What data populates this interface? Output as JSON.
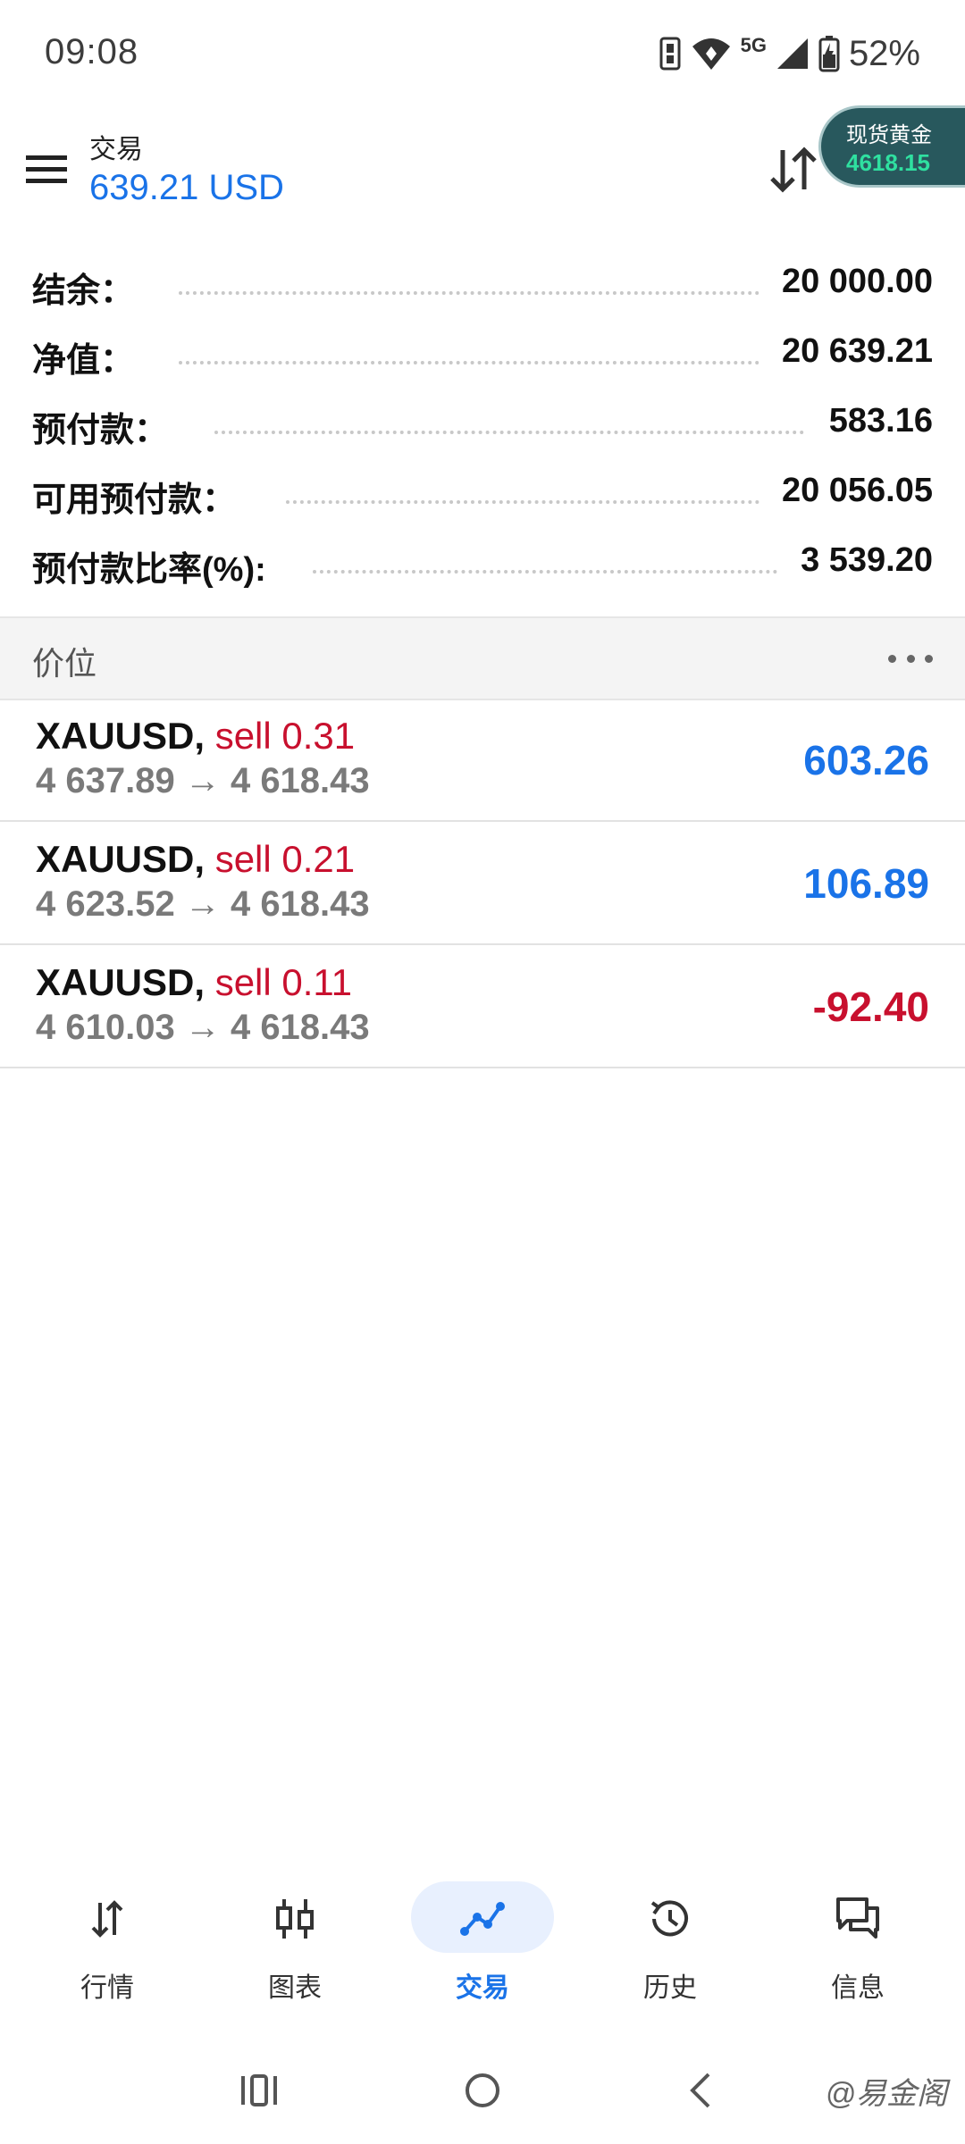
{
  "status_bar": {
    "time": "09:08",
    "network": "5G",
    "battery": "52%"
  },
  "header": {
    "title": "交易",
    "profit": "639.21 USD",
    "ticker": {
      "label": "现货黄金",
      "value": "4618.15"
    }
  },
  "summary": [
    {
      "label": "结余：",
      "value": "20 000.00"
    },
    {
      "label": "净值：",
      "value": "20 639.21"
    },
    {
      "label": "预付款：",
      "value": "583.16"
    },
    {
      "label": "可用预付款：",
      "value": "20 056.05"
    },
    {
      "label": "预付款比率(%):",
      "value": "3 539.20"
    }
  ],
  "section": {
    "title": "价位"
  },
  "positions": [
    {
      "symbol": "XAUUSD,",
      "side": "sell 0.31",
      "price_open": "4 637.89",
      "arrow": "→",
      "price_current": "4 618.43",
      "profit": "603.26"
    },
    {
      "symbol": "XAUUSD,",
      "side": "sell 0.21",
      "price_open": "4 623.52",
      "arrow": "→",
      "price_current": "4 618.43",
      "profit": "106.89"
    },
    {
      "symbol": "XAUUSD,",
      "side": "sell 0.11",
      "price_open": "4 610.03",
      "arrow": "→",
      "price_current": "4 618.43",
      "profit": "-92.40"
    }
  ],
  "colors": {
    "accent": "#1a73e8",
    "profit_positive": "#1a73e8",
    "profit_negative": "#c8102e",
    "sell": "#c8102e",
    "ticker_bg": "#28585d",
    "ticker_value": "#2fe0a0"
  },
  "bottom_nav": [
    {
      "label": "行情",
      "icon": "quotes-icon",
      "active": false
    },
    {
      "label": "图表",
      "icon": "chart-icon",
      "active": false
    },
    {
      "label": "交易",
      "icon": "trade-icon",
      "active": true
    },
    {
      "label": "历史",
      "icon": "history-icon",
      "active": false
    },
    {
      "label": "信息",
      "icon": "messages-icon",
      "active": false
    }
  ],
  "watermark": "@易金阁"
}
